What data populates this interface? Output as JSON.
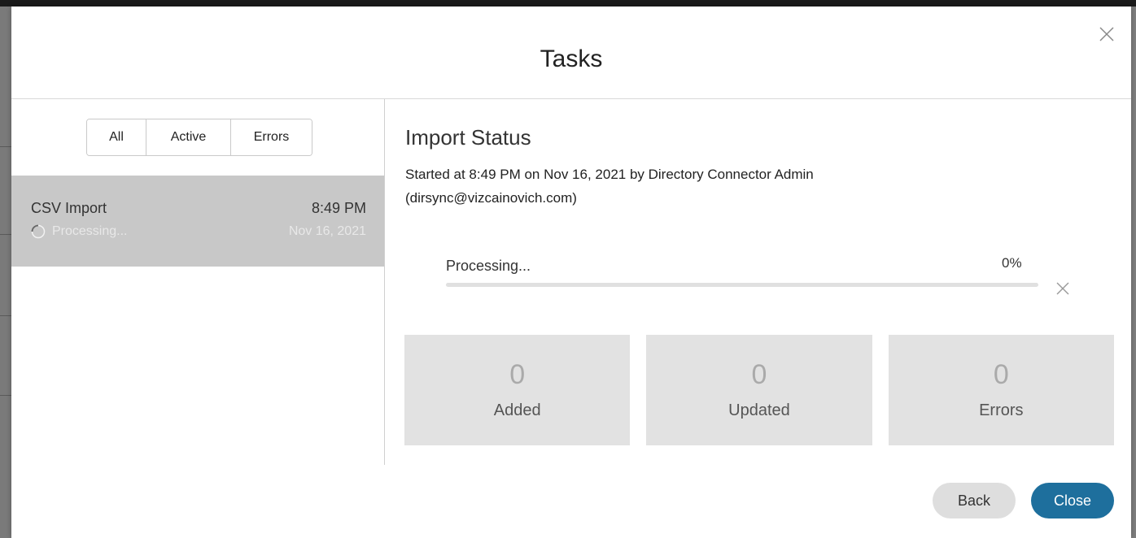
{
  "modal": {
    "title": "Tasks"
  },
  "filters": [
    {
      "label": "All"
    },
    {
      "label": "Active"
    },
    {
      "label": "Errors"
    }
  ],
  "task": {
    "name": "CSV Import",
    "time": "8:49 PM",
    "status": "Processing...",
    "date": "Nov 16, 2021"
  },
  "import_status": {
    "title": "Import Status",
    "description": "Started at 8:49 PM on Nov 16, 2021 by Directory Connector Admin (dirsync@vizcainovich.com)",
    "progress_label": "Processing...",
    "progress_percent_text": "0%",
    "progress_value": 0
  },
  "stats": [
    {
      "value": "0",
      "label": "Added"
    },
    {
      "value": "0",
      "label": "Updated"
    },
    {
      "value": "0",
      "label": "Errors"
    }
  ],
  "footer": {
    "back_label": "Back",
    "close_label": "Close"
  },
  "colors": {
    "primary": "#1e6f9d",
    "selected_row": "#c8c8c8",
    "stat_card": "#e2e2e2"
  }
}
